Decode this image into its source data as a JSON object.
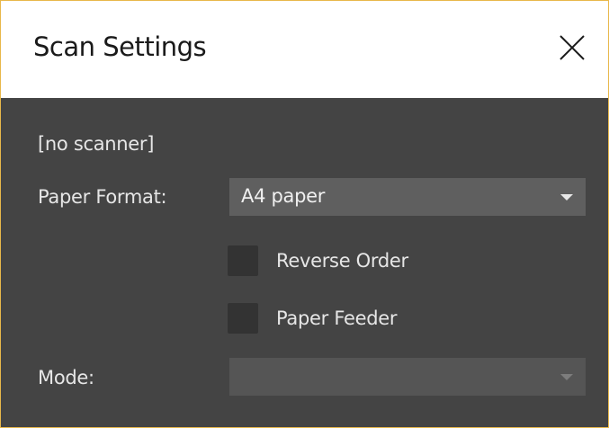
{
  "window": {
    "title": "Scan Settings",
    "close_icon": "close-icon"
  },
  "scanner": {
    "status": "[no scanner]"
  },
  "paper_format": {
    "label": "Paper Format:",
    "selected": "A4 paper",
    "icon": "chevron-down-icon"
  },
  "options": {
    "reverse_order": {
      "label": "Reverse Order",
      "checked": false
    },
    "paper_feeder": {
      "label": "Paper Feeder",
      "checked": false
    }
  },
  "mode": {
    "label": "Mode:",
    "selected": "",
    "enabled": false,
    "icon": "chevron-down-icon"
  },
  "colors": {
    "title_bar": "#ffffff",
    "body_background": "#444444",
    "window_border": "#e8b84a",
    "combo_background": "#5f5f5f",
    "checkbox_background": "#333333",
    "text": "#e6e6e6"
  }
}
